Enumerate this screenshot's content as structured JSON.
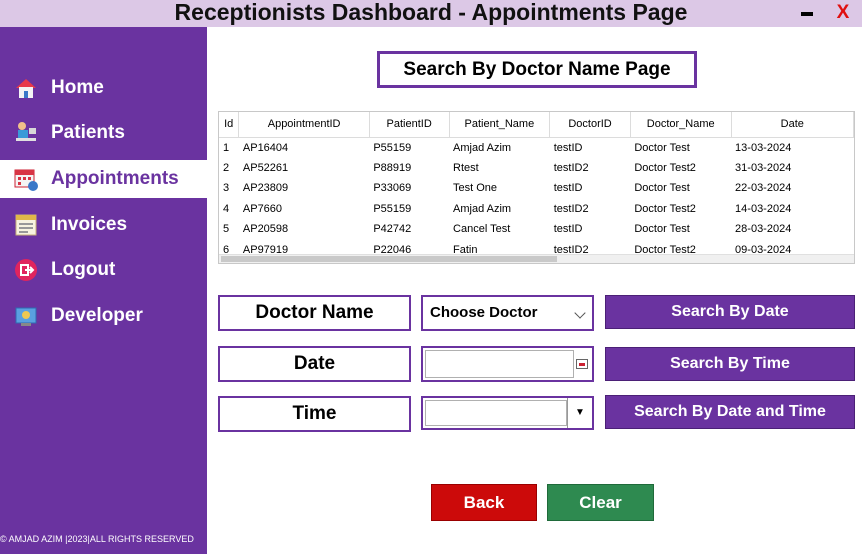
{
  "window": {
    "title": "Receptionists Dashboard - Appointments Page",
    "minimize_label": "",
    "close_label": "X"
  },
  "sidebar": {
    "items": [
      {
        "label": "Home",
        "icon": "home-icon"
      },
      {
        "label": "Patients",
        "icon": "patients-icon"
      },
      {
        "label": "Appointments",
        "icon": "calendar-icon",
        "active": true
      },
      {
        "label": "Invoices",
        "icon": "invoice-icon"
      },
      {
        "label": "Logout",
        "icon": "logout-icon"
      },
      {
        "label": "Developer",
        "icon": "developer-icon"
      }
    ],
    "copyright": "© AMJAD AZIM |2023|ALL RIGHTS RESERVED"
  },
  "heading": "Search By Doctor Name Page",
  "table": {
    "columns": [
      "Id",
      "AppointmentID",
      "PatientID",
      "Patient_Name",
      "DoctorID",
      "Doctor_Name",
      "Date"
    ],
    "rows": [
      [
        "1",
        "AP16404",
        "P55159",
        "Amjad Azim",
        "testID",
        "Doctor Test",
        "13-03-2024"
      ],
      [
        "2",
        "AP52261",
        "P88919",
        "Rtest",
        "testID2",
        "Doctor Test2",
        "31-03-2024"
      ],
      [
        "3",
        "AP23809",
        "P33069",
        "Test One",
        "testID",
        "Doctor Test",
        "22-03-2024"
      ],
      [
        "4",
        "AP7660",
        "P55159",
        "Amjad Azim",
        "testID2",
        "Doctor Test2",
        "14-03-2024"
      ],
      [
        "5",
        "AP20598",
        "P42742",
        "Cancel Test",
        "testID",
        "Doctor Test",
        "28-03-2024"
      ],
      [
        "6",
        "AP97919",
        "P22046",
        "Fatin",
        "testID2",
        "Doctor Test2",
        "09-03-2024"
      ]
    ]
  },
  "form": {
    "doctor_label": "Doctor Name",
    "doctor_select": "Choose Doctor",
    "date_label": "Date",
    "time_label": "Time",
    "search_by_date": "Search By Date",
    "search_by_time": "Search By Time",
    "search_by_date_time": "Search By Date and Time",
    "back": "Back",
    "clear": "Clear"
  },
  "colors": {
    "sidebar": "#6a33a0",
    "back_button": "#cc0a0a",
    "clear_button": "#2e8a50",
    "title_bar": "#dcc8e6"
  }
}
